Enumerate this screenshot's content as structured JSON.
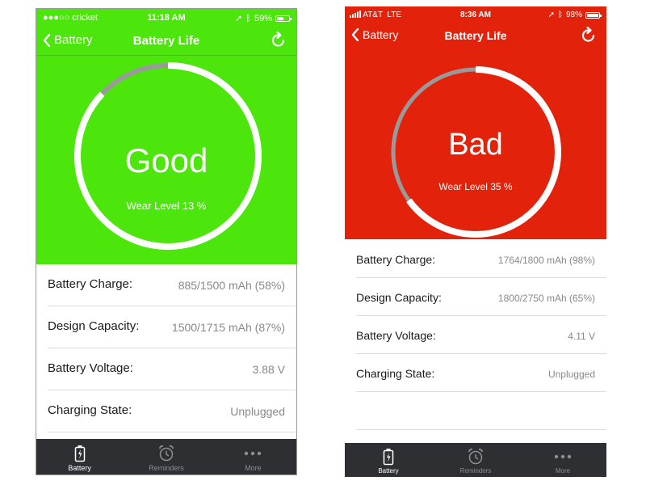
{
  "left": {
    "status": {
      "carrier": "●●●○○ cricket",
      "time": "11:18 AM",
      "battery": "59%",
      "battery_level": 0.59
    },
    "nav": {
      "back": "Battery",
      "title": "Battery Life"
    },
    "hero": {
      "grade": "Good",
      "wear": "Wear Level 13 %",
      "wear_level": 0.13,
      "color": "#4ce60c"
    },
    "rows": [
      {
        "label": "Battery Charge:",
        "value": "885/1500 mAh (58%)"
      },
      {
        "label": "Design Capacity:",
        "value": "1500/1715 mAh (87%)"
      },
      {
        "label": "Battery Voltage:",
        "value": "3.88 V"
      },
      {
        "label": "Charging State:",
        "value": "Unplugged"
      }
    ],
    "tabs": [
      {
        "label": "Battery",
        "icon": "battery-icon",
        "active": true
      },
      {
        "label": "Reminders",
        "icon": "alarm-clock-icon",
        "active": false
      },
      {
        "label": "More",
        "icon": "more-dots-icon",
        "active": false
      }
    ]
  },
  "right": {
    "status": {
      "carrier": "AT&T  LTE",
      "time": "8:36 AM",
      "battery": "98%",
      "battery_level": 0.98
    },
    "nav": {
      "back": "Battery",
      "title": "Battery Life"
    },
    "hero": {
      "grade": "Bad",
      "wear": "Wear Level 35 %",
      "wear_level": 0.35,
      "color": "#e3220c"
    },
    "rows": [
      {
        "label": "Battery Charge:",
        "value": "1764/1800 mAh (98%)"
      },
      {
        "label": "Design Capacity:",
        "value": "1800/2750 mAh (65%)"
      },
      {
        "label": "Battery Voltage:",
        "value": "4.11 V"
      },
      {
        "label": "Charging State:",
        "value": "Unplugged"
      }
    ],
    "tabs": [
      {
        "label": "Battery",
        "icon": "battery-icon",
        "active": true
      },
      {
        "label": "Reminders",
        "icon": "alarm-clock-icon",
        "active": false
      },
      {
        "label": "More",
        "icon": "more-dots-icon",
        "active": false
      }
    ]
  }
}
